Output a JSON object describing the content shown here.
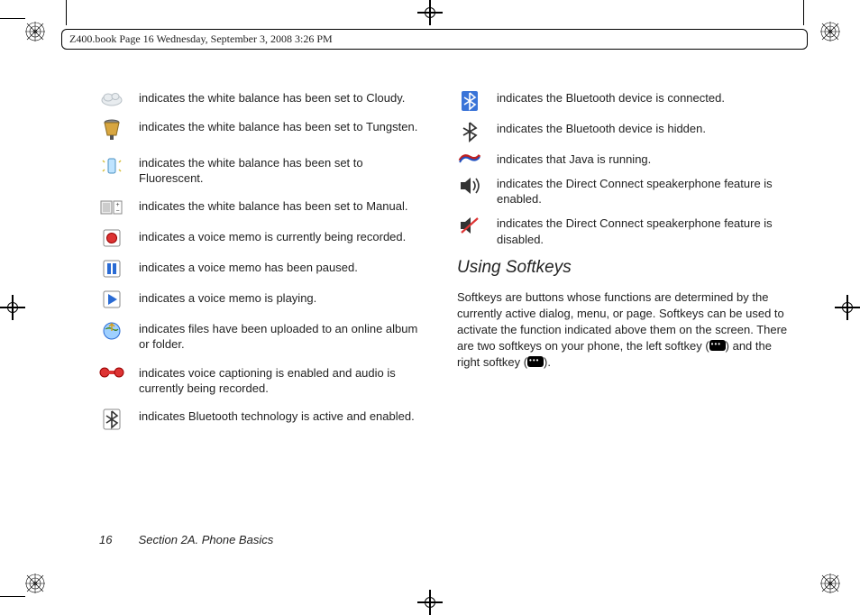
{
  "header": {
    "stamp": "Z400.book  Page 16  Wednesday, September 3, 2008  3:26 PM"
  },
  "left_icons": [
    {
      "name": "cloud-icon",
      "text": "indicates the white balance has been set to Cloudy."
    },
    {
      "name": "tungsten-icon",
      "text": "indicates the white balance has been set to Tungsten."
    },
    {
      "name": "fluorescent-icon",
      "text": "indicates the white balance has been set to Fluorescent."
    },
    {
      "name": "manual-wb-icon",
      "text": "indicates the white balance has been set to Manual."
    },
    {
      "name": "record-icon",
      "text": "indicates a voice memo is currently being recorded."
    },
    {
      "name": "pause-icon",
      "text": "indicates a voice memo has been paused."
    },
    {
      "name": "play-icon",
      "text": "indicates a voice memo is playing."
    },
    {
      "name": "globe-upload-icon",
      "text": "indicates files have been uploaded to an online album or folder."
    },
    {
      "name": "voice-caption-icon",
      "text": "indicates voice captioning is enabled and audio is currently being recorded."
    },
    {
      "name": "bluetooth-icon",
      "text": "indicates Bluetooth technology is active and enabled."
    }
  ],
  "right_icons": [
    {
      "name": "bluetooth-connected-icon",
      "text": "indicates the Bluetooth device is connected."
    },
    {
      "name": "bluetooth-hidden-icon",
      "text": "indicates the Bluetooth device is hidden."
    },
    {
      "name": "java-icon",
      "text": "indicates that Java is running."
    },
    {
      "name": "speakerphone-on-icon",
      "text": "indicates the Direct Connect speakerphone feature is enabled."
    },
    {
      "name": "speakerphone-off-icon",
      "text": "indicates the Direct Connect speakerphone feature is disabled."
    }
  ],
  "section": {
    "heading": "Using Softkeys",
    "body_pre": "Softkeys are buttons whose functions are determined by the currently active dialog, menu, or page. Softkeys can be used to activate the function indicated above them on the screen. There are two softkeys on your phone, the left softkey (",
    "body_mid": ") and the right softkey (",
    "body_post": ")."
  },
  "footer": {
    "page_number": "16",
    "section_label": "Section 2A. Phone Basics"
  }
}
